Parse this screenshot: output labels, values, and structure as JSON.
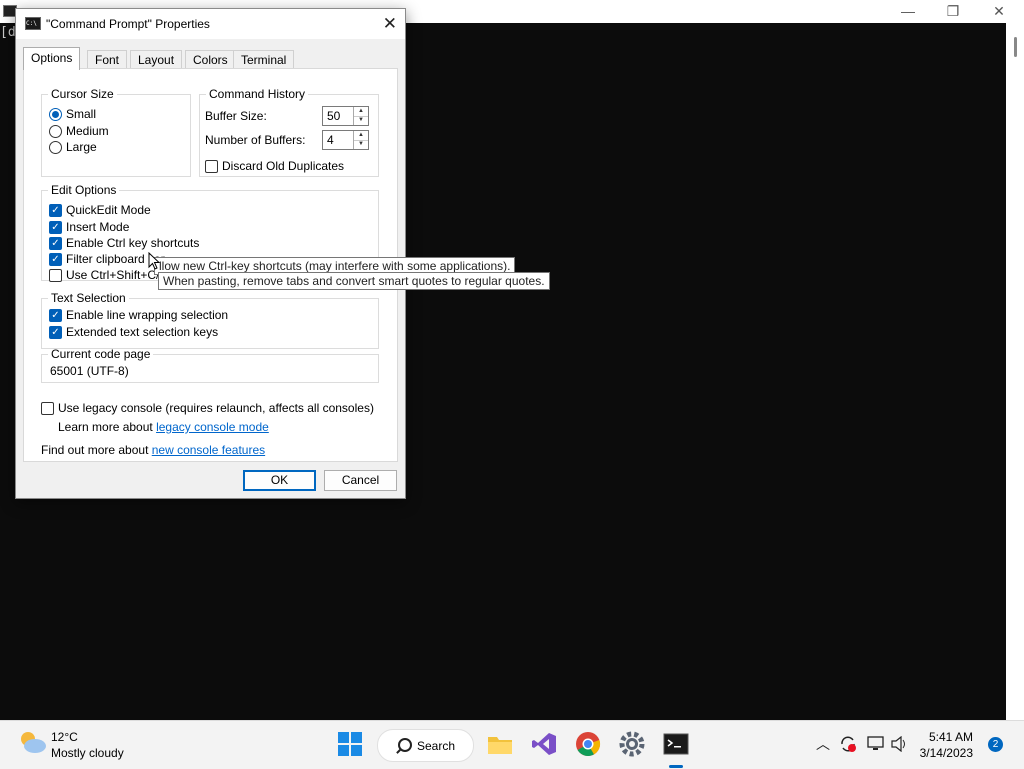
{
  "console": {
    "title": "",
    "prompt_fragment": "[d",
    "minimize_glyph": "—",
    "maximize_glyph": "❐",
    "close_glyph": "✕"
  },
  "dialog": {
    "title": "\"Command Prompt\" Properties",
    "close_glyph": "✕",
    "tabs": [
      "Options",
      "Font",
      "Layout",
      "Colors",
      "Terminal"
    ],
    "active_tab": "Options",
    "cursor_size": {
      "legend": "Cursor Size",
      "options": [
        "Small",
        "Medium",
        "Large"
      ],
      "selected": "Small"
    },
    "command_history": {
      "legend": "Command History",
      "buffer_size_label": "Buffer Size:",
      "buffer_size_value": "50",
      "number_of_buffers_label": "Number of Buffers:",
      "number_of_buffers_value": "4",
      "discard_label": "Discard Old Duplicates",
      "discard_checked": false
    },
    "edit_options": {
      "legend": "Edit Options",
      "items": [
        {
          "label": "QuickEdit Mode",
          "checked": true
        },
        {
          "label": "Insert Mode",
          "checked": true
        },
        {
          "label": "Enable Ctrl key shortcuts",
          "checked": true
        },
        {
          "label": "Filter clipboard cor",
          "checked": true
        },
        {
          "label": "Use Ctrl+Shift+C/\\",
          "checked": false
        }
      ]
    },
    "tooltips": [
      "llow new Ctrl-key shortcuts (may interfere with some applications).",
      "When pasting, remove tabs and convert smart quotes to regular quotes."
    ],
    "text_selection": {
      "legend": "Text Selection",
      "items": [
        {
          "label": "Enable line wrapping selection",
          "checked": true
        },
        {
          "label": "Extended text selection keys",
          "checked": true
        }
      ]
    },
    "code_page": {
      "legend": "Current code page",
      "value": "65001 (UTF-8)"
    },
    "legacy": {
      "label": "Use legacy console (requires relaunch, affects all consoles)",
      "checked": false,
      "learn_more_prefix": "Learn more about ",
      "learn_more_link": "legacy console mode"
    },
    "find_out_prefix": "Find out more about ",
    "find_out_link": "new console features",
    "ok_label": "OK",
    "cancel_label": "Cancel"
  },
  "taskbar": {
    "temperature": "12°C",
    "condition": "Mostly cloudy",
    "search_label": "Search",
    "time": "5:41 AM",
    "date": "3/14/2023",
    "notification_count": "2",
    "accent": "#0067c0"
  }
}
